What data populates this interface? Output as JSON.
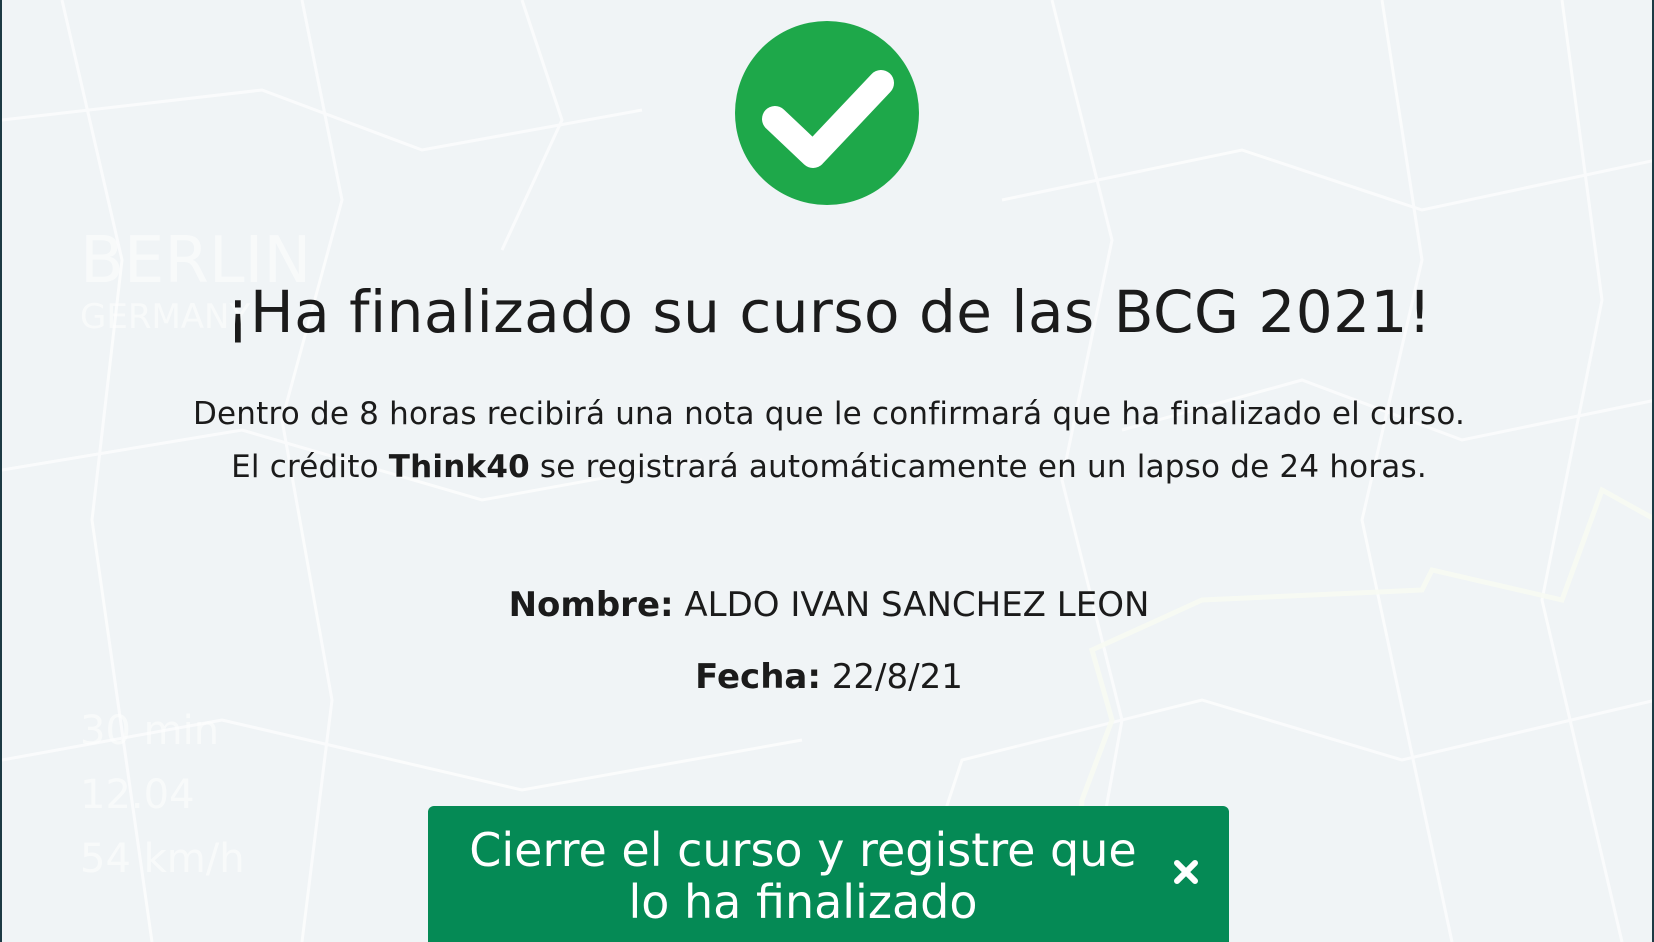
{
  "completion": {
    "title": "¡Ha finalizado su curso de las BCG 2021!",
    "message_line1": "Dentro de 8 horas recibirá una nota que le confirmará que ha finalizado el curso.",
    "message_line2_prefix": "El crédito ",
    "message_line2_brand": "Think40",
    "message_line2_suffix": " se registrará automáticamente en un lapso de 24 horas.",
    "name_label": "Nombre:",
    "name_value": "ALDO IVAN SANCHEZ LEON",
    "date_label": "Fecha:",
    "date_value": "22/8/21",
    "close_button_label": "Cierre el curso y registre que lo ha finalizado"
  },
  "icons": {
    "success": "check-circle-icon",
    "close": "close-icon"
  },
  "colors": {
    "success_green": "#1ea84a",
    "button_green": "#058a55",
    "background": "#f0f4f6",
    "frame_border": "#1d3a44",
    "text": "#1b1b1b"
  }
}
